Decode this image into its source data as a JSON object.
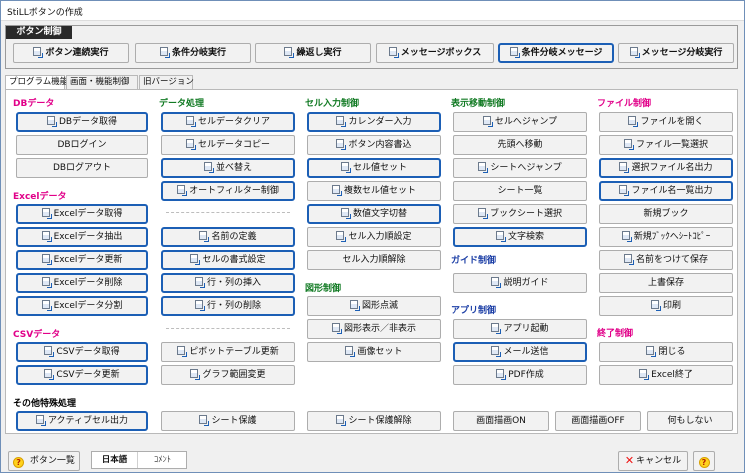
{
  "window": {
    "title": "StiLLボタンの作成"
  },
  "button_control": {
    "title": "ボタン制御",
    "buttons": [
      {
        "label": "ボタン連続実行"
      },
      {
        "label": "条件分岐実行"
      },
      {
        "label": "繰返し実行"
      },
      {
        "label": "メッセージボックス"
      },
      {
        "label": "条件分岐メッセージ"
      },
      {
        "label": "メッセージ分岐実行"
      }
    ]
  },
  "tabs": [
    {
      "label": "プログラム機能"
    },
    {
      "label": "画面・機能制御"
    },
    {
      "label": "旧バージョン"
    }
  ],
  "categories": {
    "db": "DBデータ",
    "excel": "Excelデータ",
    "csv": "CSVデータ",
    "data_processing": "データ処理",
    "cell_input": "セル入力制御",
    "shape": "図形制御",
    "display_move": "表示移動制御",
    "guide": "ガイド制御",
    "app": "アプリ制御",
    "file": "ファイル制御",
    "exit": "終了制御",
    "other": "その他特殊処理"
  },
  "buttons": {
    "db_get": "DBデータ取得",
    "db_login": "DBログイン",
    "db_logout": "DBログアウト",
    "excel_get": "Excelデータ取得",
    "excel_extract": "Excelデータ抽出",
    "excel_update": "Excelデータ更新",
    "excel_delete": "Excelデータ削除",
    "excel_split": "Excelデータ分割",
    "csv_get": "CSVデータ取得",
    "csv_update": "CSVデータ更新",
    "cell_clear": "セルデータクリア",
    "cell_copy": "セルデータコピー",
    "sort": "並べ替え",
    "autofilter": "オートフィルター制御",
    "name_define": "名前の定義",
    "cell_format": "セルの書式設定",
    "row_col_insert": "行・列の挿入",
    "row_col_delete": "行・列の削除",
    "pivot_update": "ピボットテーブル更新",
    "graph_range": "グラフ範囲変更",
    "calendar_input": "カレンダー入力",
    "button_content_write": "ボタン内容書込",
    "cell_value_set": "セル値セット",
    "multi_cell_value_set": "複数セル値セット",
    "numeric_char_switch": "数値文字切替",
    "cell_input_order_set": "セル入力順設定",
    "cell_input_order_clear": "セル入力順解除",
    "shape_blink": "図形点滅",
    "shape_show_hide": "図形表示／非表示",
    "image_set": "画像セット",
    "cell_jump": "セルへジャンプ",
    "move_to_top": "先頭へ移動",
    "sheet_jump": "シートへジャンプ",
    "sheet_list": "シート一覧",
    "book_sheet_select": "ブックシート選択",
    "text_search": "文字検索",
    "description_guide": "説明ガイド",
    "app_launch": "アプリ起動",
    "mail_send": "メール送信",
    "pdf_create": "PDF作成",
    "file_open": "ファイルを開く",
    "file_list_select": "ファイル一覧選択",
    "selected_file_output": "選択ファイル名出力",
    "file_name_list_output": "ファイル名一覧出力",
    "new_book": "新規ブック",
    "new_book_sheet_copy": "新規ﾌﾞｯｸへｼｰﾄｺﾋﾟｰ",
    "save_as": "名前をつけて保存",
    "overwrite_save": "上書保存",
    "print": "印刷",
    "close": "閉じる",
    "excel_exit": "Excel終了",
    "active_cell_output": "アクティブセル出力",
    "sheet_protect": "シート保護",
    "sheet_unprotect": "シート保護解除",
    "screen_draw_on": "画面描画ON",
    "screen_draw_off": "画面描画OFF",
    "do_nothing": "何もしない"
  },
  "footer": {
    "button_list": "ボタン一覧",
    "lang_japanese": "日本語",
    "lang_comment": "ｺﾒﾝﾄ",
    "cancel": "キャンセル",
    "help_glyph": "?"
  },
  "colors": {
    "accent": "#1c5fb5",
    "magenta": "#e10089",
    "green": "#117a23",
    "blue": "#1c3fa6",
    "title_bg": "#2a2a2a"
  }
}
